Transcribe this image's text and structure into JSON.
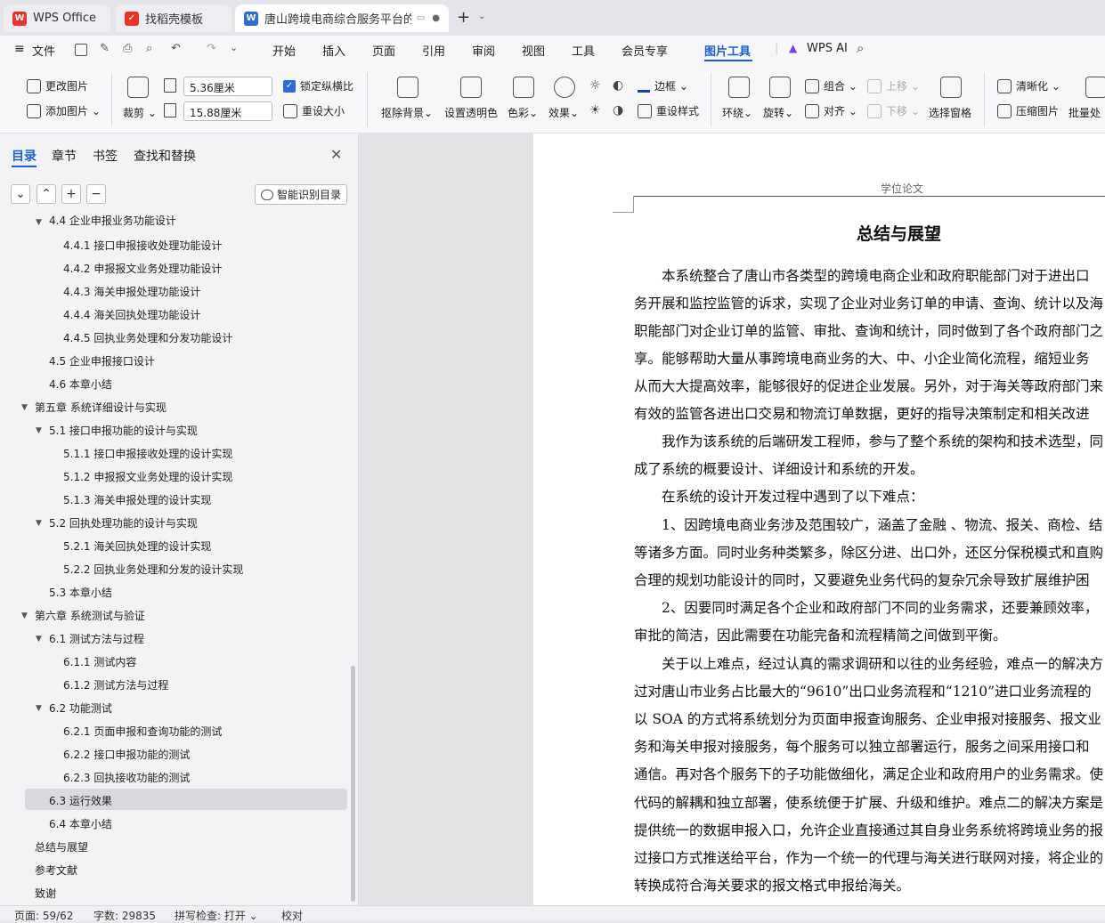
{
  "tabs": [
    {
      "label": "WPS Office"
    },
    {
      "label": "找稻壳模板"
    },
    {
      "label": "唐山跨境电商综合服务平台的设"
    }
  ],
  "menu": {
    "file": "文件",
    "items": [
      "开始",
      "插入",
      "页面",
      "引用",
      "审阅",
      "视图",
      "工具",
      "会员专享",
      "图片工具"
    ],
    "wps_ai": "WPS AI"
  },
  "ribbon": {
    "change_pic": "更改图片",
    "add_pic": "添加图片",
    "crop": "裁剪",
    "width_value": "5.36厘米",
    "height_value": "15.88厘米",
    "lock_ratio": "锁定纵横比",
    "reset_size": "重设大小",
    "remove_bg": "抠除背景",
    "set_transparent": "设置透明色",
    "color": "色彩",
    "effect": "效果",
    "border": "边框",
    "reset_style": "重设样式",
    "wrap": "环绕",
    "rotate": "旋转",
    "group": "组合",
    "align": "对齐",
    "move_up": "上移",
    "move_down": "下移",
    "select_pane": "选择窗格",
    "sharpen": "清晰化",
    "compress": "压缩图片",
    "batch": "批量处"
  },
  "sidebar": {
    "tabs": [
      "目录",
      "章节",
      "书签",
      "查找和替换"
    ],
    "smart_toc": "智能识别目录",
    "toc": [
      {
        "t": "4.4  企业申报业务功能设计"
      },
      {
        "t": "4.4.1 接口申报接收处理功能设计"
      },
      {
        "t": "4.4.2 申报报文业务处理功能设计"
      },
      {
        "t": "4.4.3 海关申报处理功能设计"
      },
      {
        "t": "4.4.4 海关回执处理功能设计"
      },
      {
        "t": "4.4.5 回执业务处理和分发功能设计"
      },
      {
        "t": "4.5  企业申报接口设计"
      },
      {
        "t": "4.6  本章小结"
      },
      {
        "t": "第五章  系统详细设计与实现"
      },
      {
        "t": "5.1  接口申报功能的设计与实现"
      },
      {
        "t": "5.1.1  接口申报接收处理的设计实现"
      },
      {
        "t": "5.1.2  申报报文业务处理的设计实现"
      },
      {
        "t": "5.1.3  海关申报处理的设计实现"
      },
      {
        "t": "5.2  回执处理功能的设计与实现"
      },
      {
        "t": "5.2.1  海关回执处理的设计实现"
      },
      {
        "t": "5.2.2  回执业务处理和分发的设计实现"
      },
      {
        "t": "5.3  本章小结"
      },
      {
        "t": "第六章  系统测试与验证"
      },
      {
        "t": "6.1  测试方法与过程"
      },
      {
        "t": "6.1.1  测试内容"
      },
      {
        "t": "6.1.2  测试方法与过程"
      },
      {
        "t": "6.2  功能测试"
      },
      {
        "t": "6.2.1  页面申报和查询功能的测试"
      },
      {
        "t": "6.2.2  接口申报功能的测试"
      },
      {
        "t": "6.2.3  回执接收功能的测试"
      },
      {
        "t": "6.3  运行效果"
      },
      {
        "t": "6.4  本章小结"
      },
      {
        "t": "总结与展望"
      },
      {
        "t": "参考文献"
      },
      {
        "t": "致谢"
      }
    ]
  },
  "doc": {
    "header": "学位论文",
    "title": "总结与展望",
    "lines": [
      "本系统整合了唐山市各类型的跨境电商企业和政府职能部门对于进出口",
      "务开展和监控监管的诉求，实现了企业对业务订单的申请、查询、统计以及海",
      "职能部门对企业订单的监管、审批、查询和统计，同时做到了各个政府部门之",
      "享。能够帮助大量从事跨境电商业务的大、中、小企业简化流程，缩短业务",
      "从而大大提高效率，能够很好的促进企业发展。另外，对于海关等政府部门来",
      "有效的监管各进出口交易和物流订单数据，更好的指导决策制定和相关改进",
      "我作为该系统的后端研发工程师，参与了整个系统的架构和技术选型，同",
      "成了系统的概要设计、详细设计和系统的开发。",
      "在系统的设计开发过程中遇到了以下难点：",
      "1、因跨境电商业务涉及范围较广，涵盖了金融 、物流、报关、商检、结",
      "等诸多方面。同时业务种类繁多，除区分进、出口外，还区分保税模式和直购",
      "合理的规划功能设计的同时，又要避免业务代码的复杂冗余导致扩展维护困",
      "2、因要同时满足各个企业和政府部门不同的业务需求，还要兼顾效率，",
      "审批的简洁，因此需要在功能完备和流程精简之间做到平衡。",
      "关于以上难点，经过认真的需求调研和以往的业务经验，难点一的解决方",
      "过对唐山市业务占比最大的“9610”出口业务流程和“1210”进口业务流程的",
      "以 SOA 的方式将系统划分为页面申报查询服务、企业申报对接服务、报文业",
      "务和海关申报对接服务，每个服务可以独立部署运行，服务之间采用接口和",
      "通信。再对各个服务下的子功能做细化，满足企业和政府用户的业务需求。使",
      "代码的解耦和独立部署，使系统便于扩展、升级和维护。难点二的解决方案是",
      "提供统一的数据申报入口，允许企业直接通过其自身业务系统将跨境业务的报",
      "过接口方式推送给平台，作为一个统一的代理与海关进行联网对接，将企业的",
      "转换成符合海关要求的报文格式申报给海关。"
    ]
  },
  "status": {
    "page": "页面: 59/62",
    "words": "字数: 29835",
    "spell": "拼写检查: 打开",
    "proof": "校对"
  }
}
